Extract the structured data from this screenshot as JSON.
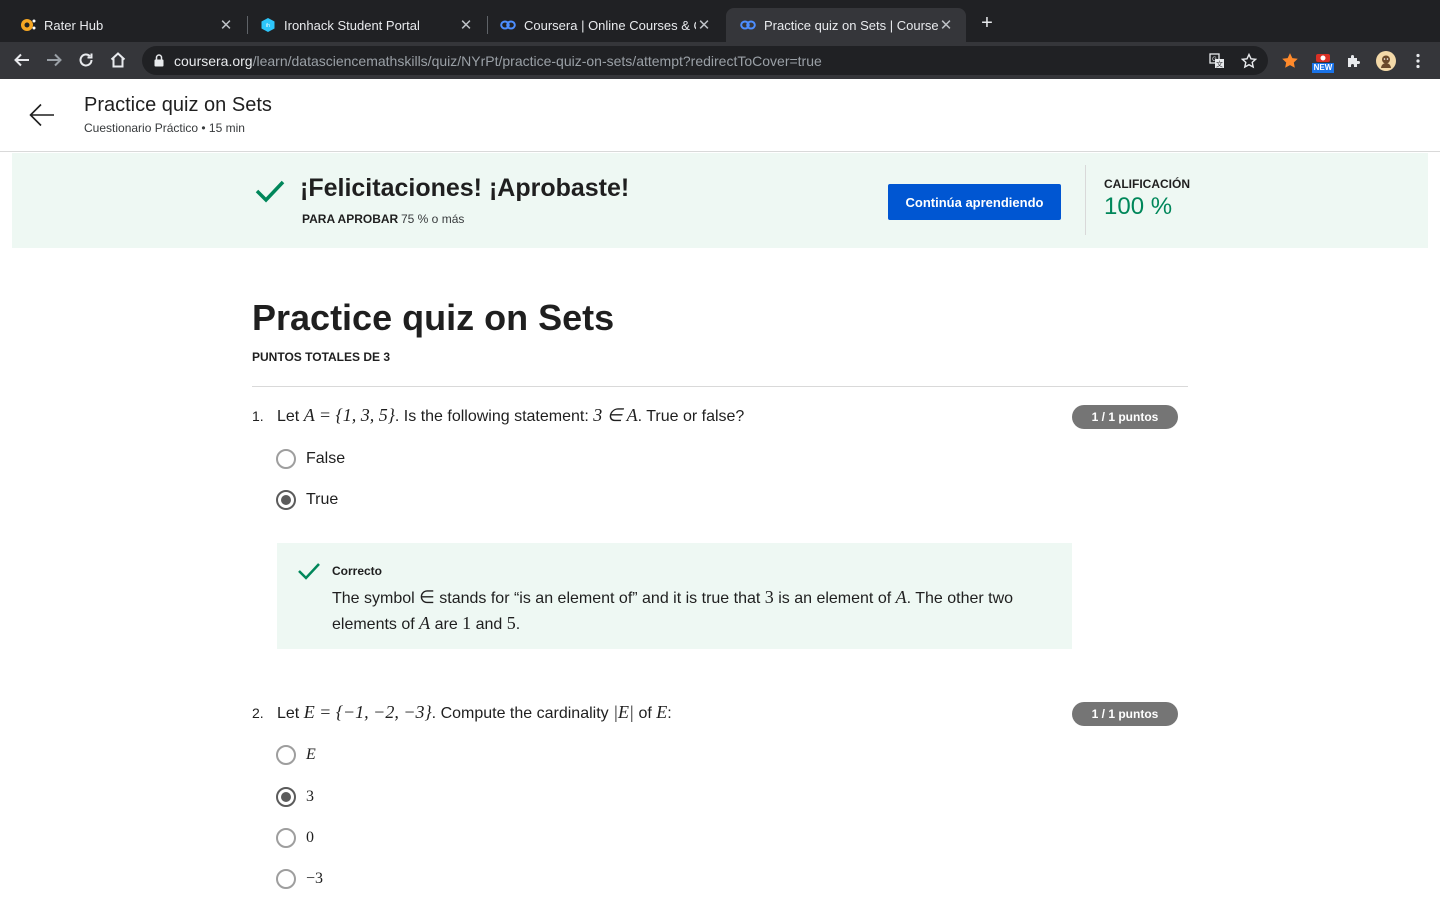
{
  "browser": {
    "tabs": [
      {
        "title": "Rater Hub",
        "icon": "rater-hub-favicon"
      },
      {
        "title": "Ironhack Student Portal",
        "icon": "ironhack-favicon"
      },
      {
        "title": "Coursera | Online Courses & Cr",
        "icon": "coursera-favicon"
      },
      {
        "title": "Practice quiz on Sets | Courser",
        "icon": "coursera-favicon",
        "active": true
      }
    ],
    "url_host": "coursera.org",
    "url_path": "/learn/datasciencemathskills/quiz/NYrPt/practice-quiz-on-sets/attempt?redirectToCover=true",
    "ext_badge": "NEW"
  },
  "header": {
    "title": "Practice quiz on Sets",
    "subtitle": "Cuestionario Práctico • 15 min"
  },
  "banner": {
    "congrats": "¡Felicitaciones! ¡Aprobaste!",
    "pass_label": "PARA APROBAR",
    "pass_value": "75 % o más",
    "continue_label": "Continúa aprendiendo",
    "grade_label": "CALIFICACIÓN",
    "grade_value": "100 %"
  },
  "quiz": {
    "title": "Practice quiz on Sets",
    "total": "PUNTOS TOTALES DE 3",
    "questions": [
      {
        "number": "1.",
        "points": "1 / 1 puntos",
        "text_parts": [
          "Let ",
          "A = {1, 3, 5}",
          ". Is the following statement: ",
          "3 ∈ A",
          ". True or false?"
        ],
        "options": [
          {
            "label": "False",
            "selected": false
          },
          {
            "label": "True",
            "selected": true
          }
        ],
        "feedback": {
          "heading": "Correcto",
          "parts": [
            "The symbol ",
            "∈",
            " stands for “is an element of” and it is true that ",
            "3",
            " is an element of ",
            "A",
            ". The other two elements of ",
            "A",
            " are ",
            "1",
            " and ",
            "5",
            "."
          ]
        }
      },
      {
        "number": "2.",
        "points": "1 / 1 puntos",
        "text_parts": [
          "Let ",
          "E = {−1, −2, −3}",
          ". Compute the cardinality ",
          "|E|",
          " of ",
          "E",
          ":"
        ],
        "options": [
          {
            "label": "E",
            "selected": false
          },
          {
            "label": "3",
            "selected": true
          },
          {
            "label": "0",
            "selected": false
          },
          {
            "label": "−3",
            "selected": false
          }
        ]
      }
    ]
  },
  "colors": {
    "accent_blue": "#0056d2",
    "success_green": "#00875a",
    "banner_bg": "#eef8f3"
  }
}
